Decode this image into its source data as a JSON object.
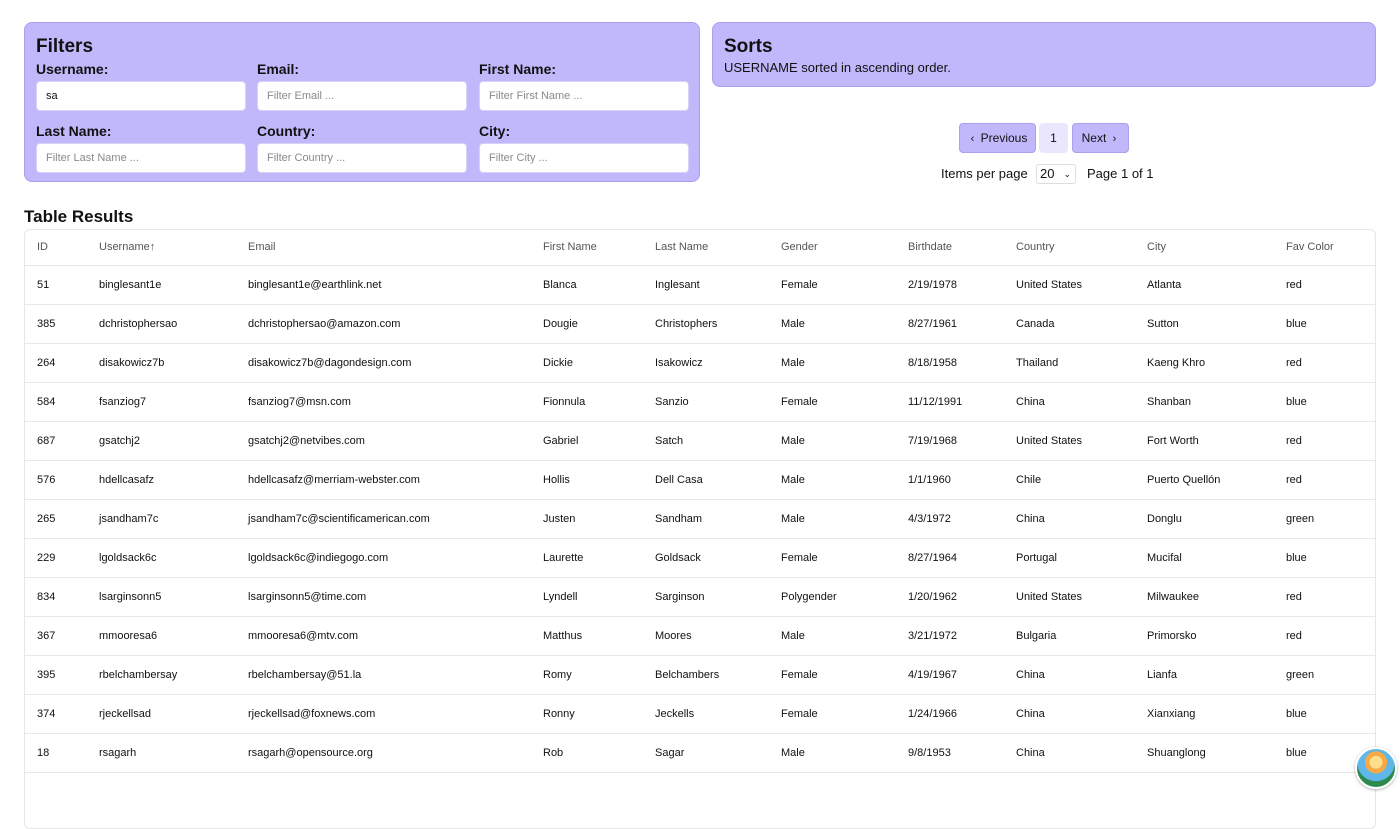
{
  "filters": {
    "title": "Filters",
    "username": {
      "label": "Username:",
      "value": "sa",
      "placeholder": ""
    },
    "email": {
      "label": "Email:",
      "value": "",
      "placeholder": "Filter Email ..."
    },
    "first_name": {
      "label": "First Name:",
      "value": "",
      "placeholder": "Filter First Name ..."
    },
    "last_name": {
      "label": "Last Name:",
      "value": "",
      "placeholder": "Filter Last Name ..."
    },
    "country": {
      "label": "Country:",
      "value": "",
      "placeholder": "Filter Country ..."
    },
    "city": {
      "label": "City:",
      "value": "",
      "placeholder": "Filter City ..."
    }
  },
  "sorts": {
    "title": "Sorts",
    "description": "USERNAME sorted in ascending order."
  },
  "pagination": {
    "previous": "Previous",
    "page": "1",
    "next": "Next",
    "items_per_page_label": "Items per page",
    "items_per_page": "20",
    "page_info": "Page 1 of 1"
  },
  "table": {
    "title": "Table Results",
    "headers": [
      "ID",
      "Username↑",
      "Email",
      "First Name",
      "Last Name",
      "Gender",
      "Birthdate",
      "Country",
      "City",
      "Fav Color"
    ],
    "rows": [
      [
        "51",
        "binglesant1e",
        "binglesant1e@earthlink.net",
        "Blanca",
        "Inglesant",
        "Female",
        "2/19/1978",
        "United States",
        "Atlanta",
        "red"
      ],
      [
        "385",
        "dchristophersao",
        "dchristophersao@amazon.com",
        "Dougie",
        "Christophers",
        "Male",
        "8/27/1961",
        "Canada",
        "Sutton",
        "blue"
      ],
      [
        "264",
        "disakowicz7b",
        "disakowicz7b@dagondesign.com",
        "Dickie",
        "Isakowicz",
        "Male",
        "8/18/1958",
        "Thailand",
        "Kaeng Khro",
        "red"
      ],
      [
        "584",
        "fsanziog7",
        "fsanziog7@msn.com",
        "Fionnula",
        "Sanzio",
        "Female",
        "11/12/1991",
        "China",
        "Shanban",
        "blue"
      ],
      [
        "687",
        "gsatchj2",
        "gsatchj2@netvibes.com",
        "Gabriel",
        "Satch",
        "Male",
        "7/19/1968",
        "United States",
        "Fort Worth",
        "red"
      ],
      [
        "576",
        "hdellcasafz",
        "hdellcasafz@merriam-webster.com",
        "Hollis",
        "Dell Casa",
        "Male",
        "1/1/1960",
        "Chile",
        "Puerto Quellón",
        "red"
      ],
      [
        "265",
        "jsandham7c",
        "jsandham7c@scientificamerican.com",
        "Justen",
        "Sandham",
        "Male",
        "4/3/1972",
        "China",
        "Donglu",
        "green"
      ],
      [
        "229",
        "lgoldsack6c",
        "lgoldsack6c@indiegogo.com",
        "Laurette",
        "Goldsack",
        "Female",
        "8/27/1964",
        "Portugal",
        "Mucifal",
        "blue"
      ],
      [
        "834",
        "lsarginsonn5",
        "lsarginsonn5@time.com",
        "Lyndell",
        "Sarginson",
        "Polygender",
        "1/20/1962",
        "United States",
        "Milwaukee",
        "red"
      ],
      [
        "367",
        "mmooresa6",
        "mmooresa6@mtv.com",
        "Matthus",
        "Moores",
        "Male",
        "3/21/1972",
        "Bulgaria",
        "Primorsko",
        "red"
      ],
      [
        "395",
        "rbelchambersay",
        "rbelchambersay@51.la",
        "Romy",
        "Belchambers",
        "Female",
        "4/19/1967",
        "China",
        "Lianfa",
        "green"
      ],
      [
        "374",
        "rjeckellsad",
        "rjeckellsad@foxnews.com",
        "Ronny",
        "Jeckells",
        "Female",
        "1/24/1966",
        "China",
        "Xianxiang",
        "blue"
      ],
      [
        "18",
        "rsagarh",
        "rsagarh@opensource.org",
        "Rob",
        "Sagar",
        "Male",
        "9/8/1953",
        "China",
        "Shuanglong",
        "blue"
      ]
    ]
  },
  "icons": {
    "previous": "chevron-left-icon",
    "next": "chevron-right-icon",
    "select": "chevron-down-icon"
  }
}
